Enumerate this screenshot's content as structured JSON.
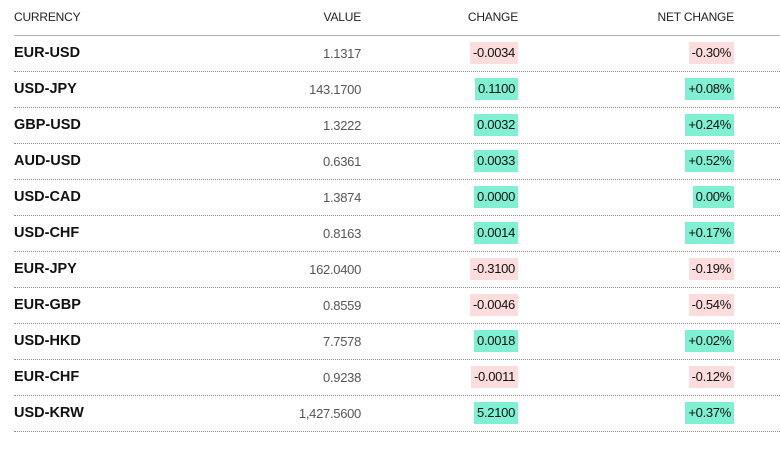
{
  "header": {
    "currency": "CURRENCY",
    "value": "VALUE",
    "change": "CHANGE",
    "net_change": "NET CHANGE"
  },
  "colors": {
    "positive_bg": "#7ff0d2",
    "negative_bg": "#fcdcdc"
  },
  "rows": [
    {
      "currency": "EUR-USD",
      "value": "1.1317",
      "change": "-0.0034",
      "net_change": "-0.30%",
      "direction": "neg"
    },
    {
      "currency": "USD-JPY",
      "value": "143.1700",
      "change": "0.1100",
      "net_change": "+0.08%",
      "direction": "pos"
    },
    {
      "currency": "GBP-USD",
      "value": "1.3222",
      "change": "0.0032",
      "net_change": "+0.24%",
      "direction": "pos"
    },
    {
      "currency": "AUD-USD",
      "value": "0.6361",
      "change": "0.0033",
      "net_change": "+0.52%",
      "direction": "pos"
    },
    {
      "currency": "USD-CAD",
      "value": "1.3874",
      "change": "0.0000",
      "net_change": "0.00%",
      "direction": "pos"
    },
    {
      "currency": "USD-CHF",
      "value": "0.8163",
      "change": "0.0014",
      "net_change": "+0.17%",
      "direction": "pos"
    },
    {
      "currency": "EUR-JPY",
      "value": "162.0400",
      "change": "-0.3100",
      "net_change": "-0.19%",
      "direction": "neg"
    },
    {
      "currency": "EUR-GBP",
      "value": "0.8559",
      "change": "-0.0046",
      "net_change": "-0.54%",
      "direction": "neg"
    },
    {
      "currency": "USD-HKD",
      "value": "7.7578",
      "change": "0.0018",
      "net_change": "+0.02%",
      "direction": "pos"
    },
    {
      "currency": "EUR-CHF",
      "value": "0.9238",
      "change": "-0.0011",
      "net_change": "-0.12%",
      "direction": "neg"
    },
    {
      "currency": "USD-KRW",
      "value": "1,427.5600",
      "change": "5.2100",
      "net_change": "+0.37%",
      "direction": "pos"
    }
  ]
}
